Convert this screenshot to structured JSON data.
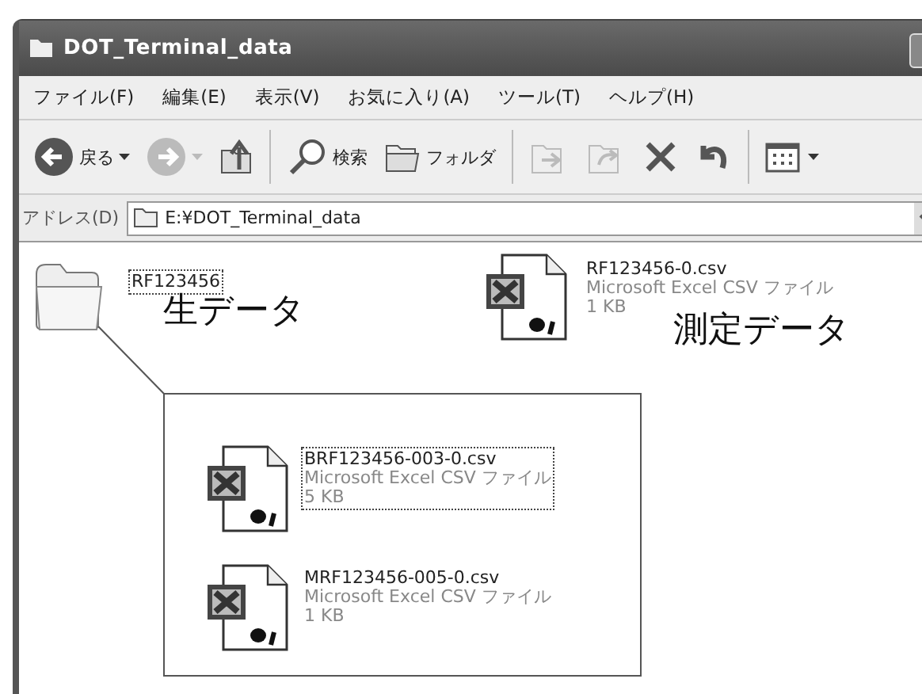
{
  "window": {
    "title": "DOT_Terminal_data"
  },
  "menu": [
    {
      "label": "ファイル(F)"
    },
    {
      "label": "編集(E)"
    },
    {
      "label": "表示(V)"
    },
    {
      "label": "お気に入り(A)"
    },
    {
      "label": "ツール(T)"
    },
    {
      "label": "ヘルプ(H)"
    }
  ],
  "toolbar": [
    {
      "kind": "back",
      "label": "戻る",
      "disabled": false
    },
    {
      "kind": "forward",
      "disabled": true
    },
    {
      "kind": "up",
      "disabled": false
    },
    {
      "kind": "separator"
    },
    {
      "kind": "search",
      "label": "検索",
      "disabled": false
    },
    {
      "kind": "folders",
      "label": "フォルダ",
      "disabled": false
    },
    {
      "kind": "separator"
    },
    {
      "kind": "move",
      "disabled": true
    },
    {
      "kind": "copy",
      "disabled": true
    },
    {
      "kind": "delete",
      "disabled": false
    },
    {
      "kind": "undo",
      "disabled": false
    },
    {
      "kind": "separator"
    },
    {
      "kind": "views",
      "disabled": false
    }
  ],
  "address": {
    "label": "アドレス(D)",
    "value": "E:¥DOT_Terminal_data"
  },
  "items": [
    {
      "kind": "folder",
      "name": "RF123456",
      "selected": true
    },
    {
      "kind": "file",
      "name": "RF123456-0.csv",
      "type": "Microsoft Excel CSV ファイル",
      "size": "1 KB",
      "selected": false
    }
  ],
  "annotations": [
    {
      "text": "生データ"
    },
    {
      "text": "測定データ"
    }
  ],
  "callout": {
    "items": [
      {
        "name": "BRF123456-003-0.csv",
        "type": "Microsoft Excel CSV ファイル",
        "size": "5 KB",
        "selected": true
      },
      {
        "name": "MRF123456-005-0.csv",
        "type": "Microsoft Excel CSV ファイル",
        "size": "1 KB",
        "selected": false
      }
    ]
  }
}
